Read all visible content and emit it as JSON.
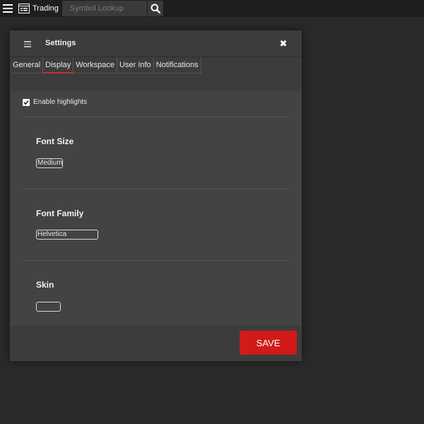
{
  "topbar": {
    "trading_label": "Trading",
    "symbol_placeholder": "Symbol Lookup",
    "icons": [
      "hamburger-menu-icon",
      "trading-window-icon",
      "search-icon"
    ]
  },
  "dialog": {
    "title": "Settings",
    "close_glyph": "✖",
    "tabs": [
      {
        "label": "General",
        "active": false
      },
      {
        "label": "Display",
        "active": true
      },
      {
        "label": "Workspace",
        "active": false
      },
      {
        "label": "User Info",
        "active": false
      },
      {
        "label": "Notifications",
        "active": false
      }
    ],
    "enable_highlights": {
      "label": "Enable highlights",
      "checked": true
    },
    "font_size": {
      "title": "Font Size",
      "value": "Medium"
    },
    "font_family": {
      "title": "Font Family",
      "value": "Helvetica"
    },
    "skin": {
      "title": "Skin",
      "value": ""
    },
    "save_label": "SAVE"
  },
  "colors": {
    "accent": "#d11a1a",
    "active_tab_underline": "#c4312b",
    "background": "#2a2a2a",
    "panel": "#3c3c3c"
  }
}
